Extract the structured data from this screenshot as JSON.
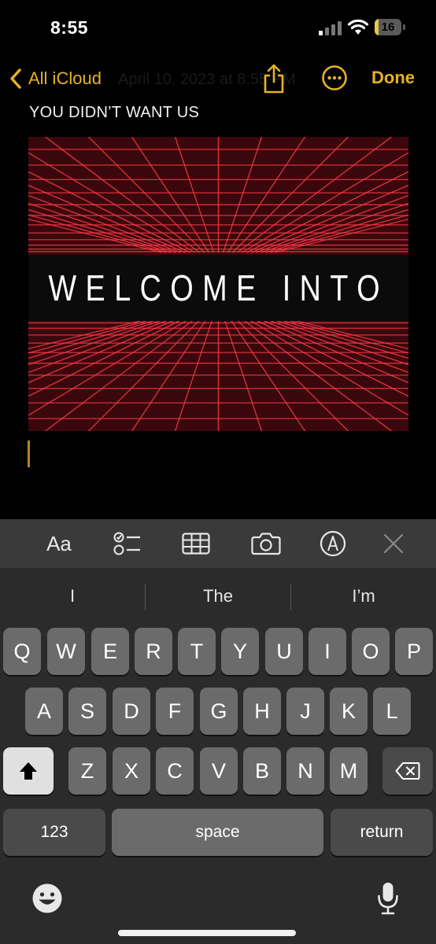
{
  "status_bar": {
    "time": "8:55",
    "battery_percent": "16",
    "battery_level": 0.16
  },
  "nav": {
    "back_label": "All iCloud",
    "faded_title": "April 10, 2023 at 8:55 PM",
    "done_label": "Done"
  },
  "note": {
    "line1": "YOU DIDN’T WANT US",
    "attachment_text": "WELCOME INTO"
  },
  "toolbar": {
    "format_label": "Aa"
  },
  "suggestions": [
    "I",
    "The",
    "I’m"
  ],
  "keyboard": {
    "row1": [
      "Q",
      "W",
      "E",
      "R",
      "T",
      "Y",
      "U",
      "I",
      "O",
      "P"
    ],
    "row2": [
      "A",
      "S",
      "D",
      "F",
      "G",
      "H",
      "J",
      "K",
      "L"
    ],
    "row3": [
      "Z",
      "X",
      "C",
      "V",
      "B",
      "N",
      "M"
    ],
    "numbers_label": "123",
    "space_label": "space",
    "return_label": "return"
  },
  "colors": {
    "accent": "#e6b325",
    "grid": "#ff3a4a"
  }
}
